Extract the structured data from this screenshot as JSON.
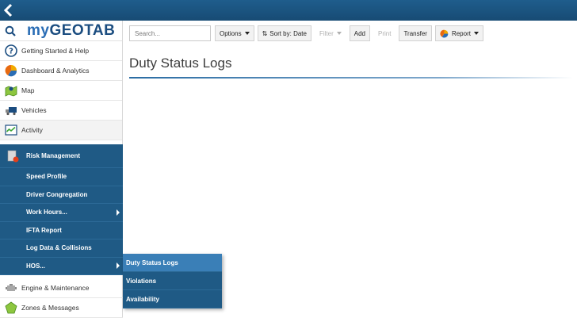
{
  "app": {
    "logo_prefix": "my",
    "logo_main": "GEOTAB"
  },
  "sidebar": {
    "items": [
      {
        "label": "Getting Started & Help",
        "icon": "help-icon"
      },
      {
        "label": "Dashboard & Analytics",
        "icon": "pie-chart-icon"
      },
      {
        "label": "Map",
        "icon": "map-icon"
      },
      {
        "label": "Vehicles",
        "icon": "vehicle-icon"
      },
      {
        "label": "Activity",
        "icon": "activity-chart-icon"
      }
    ],
    "submenu": [
      {
        "label": "Risk Management",
        "icon": "risk-icon"
      },
      {
        "label": "Speed Profile"
      },
      {
        "label": "Driver Congregation"
      },
      {
        "label": "Work Hours..."
      },
      {
        "label": "IFTA Report"
      },
      {
        "label": "Log Data & Collisions"
      },
      {
        "label": "HOS..."
      }
    ],
    "lower_items": [
      {
        "label": "Engine & Maintenance",
        "icon": "engine-icon"
      },
      {
        "label": "Zones & Messages",
        "icon": "zones-icon"
      }
    ]
  },
  "flyout": {
    "items": [
      {
        "label": "Duty Status Logs"
      },
      {
        "label": "Violations"
      },
      {
        "label": "Availability"
      }
    ]
  },
  "toolbar": {
    "search_placeholder": "Search...",
    "options_label": "Options",
    "sort_label": "Sort by: Date",
    "filter_label": "Filter",
    "add_label": "Add",
    "print_label": "Print",
    "transfer_label": "Transfer",
    "report_label": "Report"
  },
  "main": {
    "title": "Duty Status Logs"
  },
  "colors": {
    "topbar": "#1f5d8c",
    "submenu_bg": "#1f5a85",
    "selected_item": "#3a7fb7",
    "logo": "#1b4d80"
  }
}
